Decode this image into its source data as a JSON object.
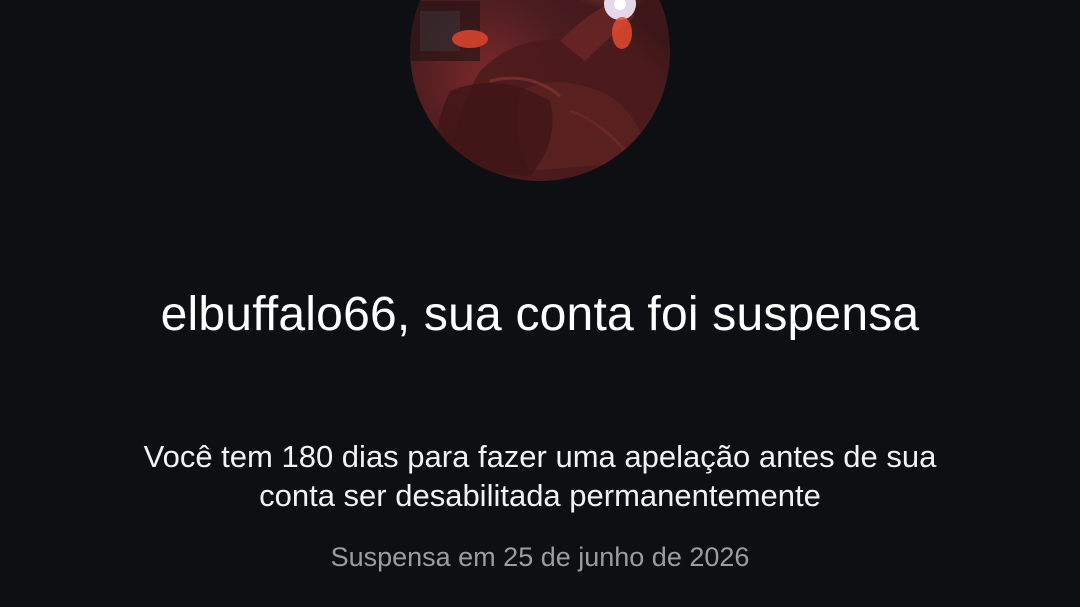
{
  "suspension": {
    "username": "elbuffalo66",
    "title": "elbuffalo66, sua conta foi suspensa",
    "message": "Você tem 180 dias para fazer uma apelação antes de sua conta ser desabilitada permanentemente",
    "suspended_on": "Suspensa em 25 de junho de 2026"
  },
  "avatar": {
    "icon": "profile-photo",
    "tone": "#5a1e22"
  },
  "colors": {
    "background": "#0d0f13",
    "title_text": "#ffffff",
    "body_text": "#f2f2f2",
    "muted_text": "#9a9ca2"
  }
}
